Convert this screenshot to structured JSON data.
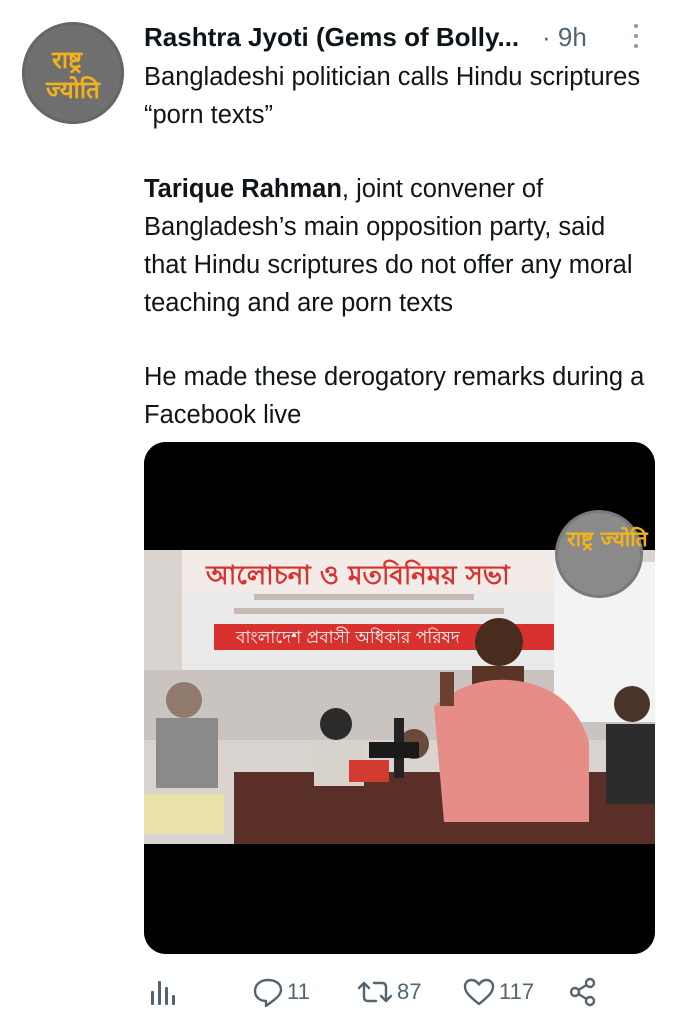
{
  "author": {
    "name": "Rashtra Jyoti (Gems of Bolly...",
    "separator": "·",
    "time": "9h",
    "avatar_logo_text": "राष्ट्र ज्योति"
  },
  "tweet": {
    "headline": "Bangladeshi politician calls Hindu scriptures “porn texts”",
    "name_bold": "Tarique Rahman",
    "body_rest": ", joint convener of Bangladesh’s main opposition party, said that Hindu scriptures do not offer any moral teaching and are porn texts",
    "closing": "He made these derogatory remarks during a Facebook live"
  },
  "media": {
    "banner_text": "আলোচনা ও মতবিনিময় সভা",
    "banner_subtext": "বাংলাদেশ প্রবাসী অধিকার পরিষদ",
    "watermark_text": "राष्ट्र ज्योति"
  },
  "actions": {
    "views_icon": "bar-chart-icon",
    "replies": "11",
    "retweets": "87",
    "likes": "117",
    "share_icon": "share-icon"
  },
  "colors": {
    "text": "#0f1419",
    "muted": "#536471",
    "icon": "#536471",
    "logo_text": "#f2b21b"
  }
}
